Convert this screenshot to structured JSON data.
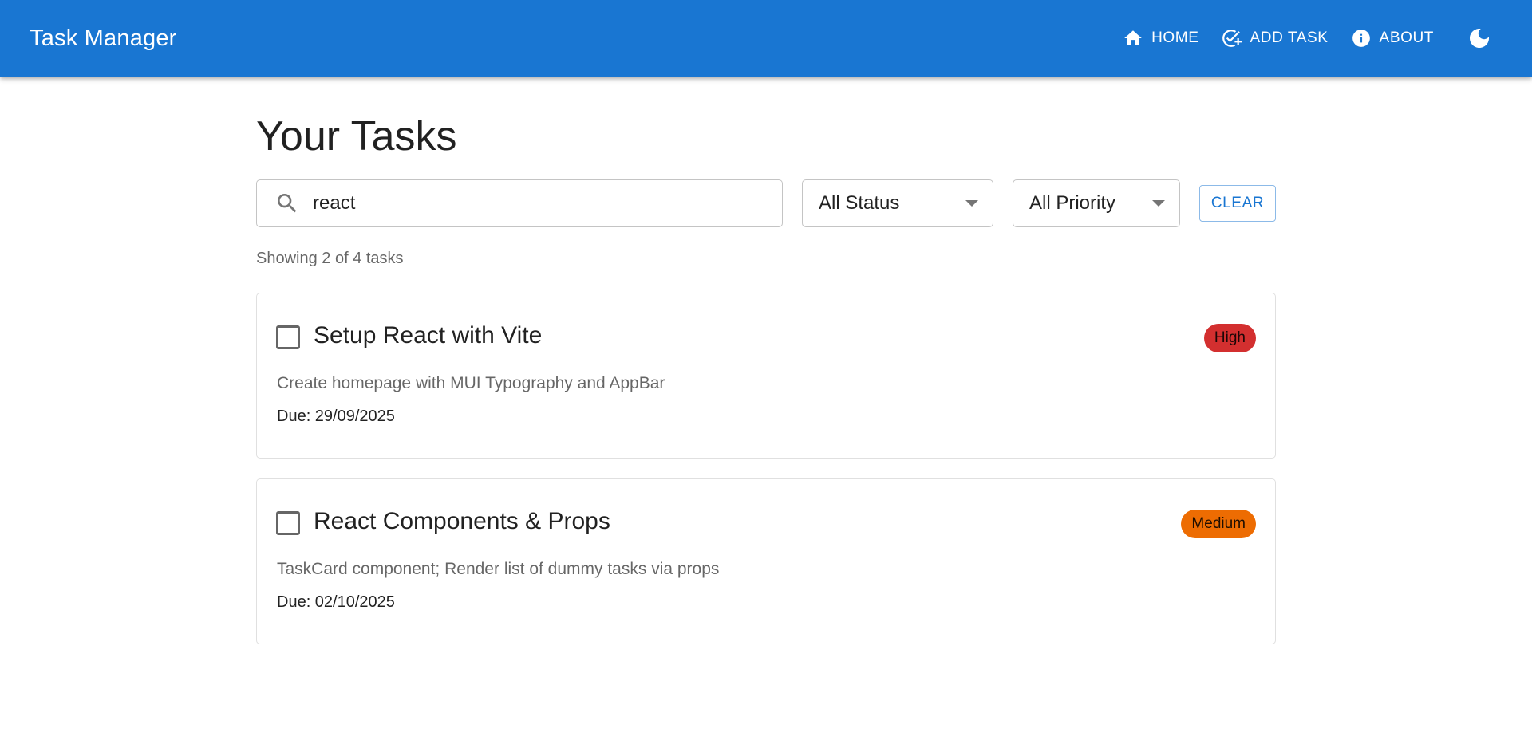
{
  "app": {
    "title": "Task Manager",
    "nav": {
      "home": {
        "label": "HOME",
        "icon": "home-icon"
      },
      "add_task": {
        "label": "ADD TASK",
        "icon": "add-task-icon"
      },
      "about": {
        "label": "ABOUT",
        "icon": "info-icon"
      },
      "theme_toggle_icon": "dark-mode-moon-icon"
    },
    "colors": {
      "primary": "#1976d2",
      "high": "#d32f2f",
      "medium": "#ed6c02"
    }
  },
  "page": {
    "title": "Your Tasks",
    "search": {
      "value": "react",
      "icon": "search-icon"
    },
    "status_filter": {
      "selected": "All Status"
    },
    "priority_filter": {
      "selected": "All Priority"
    },
    "clear_label": "CLEAR",
    "showing_text": "Showing 2 of 4 tasks"
  },
  "tasks": [
    {
      "title": "Setup React with Vite",
      "priority": "High",
      "description": "Create homepage with MUI Typography and AppBar",
      "due": "Due: 29/09/2025",
      "completed": false
    },
    {
      "title": "React Components & Props",
      "priority": "Medium",
      "description": "TaskCard component; Render list of dummy tasks via props",
      "due": "Due: 02/10/2025",
      "completed": false
    }
  ]
}
